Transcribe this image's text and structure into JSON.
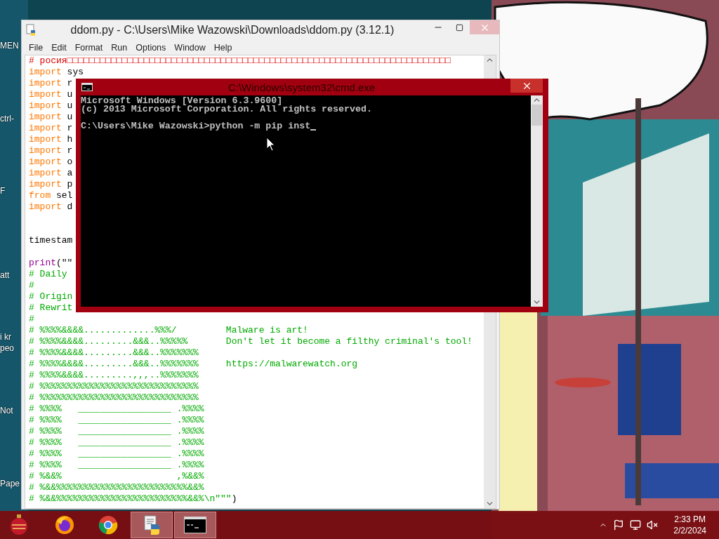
{
  "desktop_icons": [
    {
      "label": "MEN"
    },
    {
      "label": "ctrl-"
    },
    {
      "label": "F"
    },
    {
      "label": "att"
    },
    {
      "label": "i kr"
    },
    {
      "label": "peo"
    },
    {
      "label": "Not"
    },
    {
      "label": "Pape"
    }
  ],
  "editor": {
    "title": "ddom.py - C:\\Users\\Mike Wazowski\\Downloads\\ddom.py (3.12.1)",
    "menu": [
      "File",
      "Edit",
      "Format",
      "Run",
      "Options",
      "Window",
      "Help"
    ],
    "lines": [
      {
        "kind": "code",
        "segments": [
          {
            "text": "# росия□□□□□□□□□□□□□□□□□□□□□□□□□□□□□□□□□□□□□□□□□□□□□□□□□□□□□□□□□□□□□□□□□□□□□□",
            "kind": "comment"
          }
        ]
      },
      {
        "kind": "code",
        "segments": [
          {
            "text": "import",
            "kind": "keyword"
          },
          {
            "text": " sys",
            "kind": "plain"
          }
        ]
      },
      {
        "kind": "code",
        "segments": [
          {
            "text": "import",
            "kind": "keyword"
          },
          {
            "text": " r",
            "kind": "plain"
          }
        ]
      },
      {
        "kind": "code",
        "segments": [
          {
            "text": "import",
            "kind": "keyword"
          },
          {
            "text": " u",
            "kind": "plain"
          }
        ]
      },
      {
        "kind": "code",
        "segments": [
          {
            "text": "import",
            "kind": "keyword"
          },
          {
            "text": " u",
            "kind": "plain"
          }
        ]
      },
      {
        "kind": "code",
        "segments": [
          {
            "text": "import",
            "kind": "keyword"
          },
          {
            "text": " u",
            "kind": "plain"
          }
        ]
      },
      {
        "kind": "code",
        "segments": [
          {
            "text": "import",
            "kind": "keyword"
          },
          {
            "text": " r",
            "kind": "plain"
          }
        ]
      },
      {
        "kind": "code",
        "segments": [
          {
            "text": "import",
            "kind": "keyword"
          },
          {
            "text": " h",
            "kind": "plain"
          }
        ]
      },
      {
        "kind": "code",
        "segments": [
          {
            "text": "import",
            "kind": "keyword"
          },
          {
            "text": " r",
            "kind": "plain"
          }
        ]
      },
      {
        "kind": "code",
        "segments": [
          {
            "text": "import",
            "kind": "keyword"
          },
          {
            "text": " o",
            "kind": "plain"
          }
        ]
      },
      {
        "kind": "code",
        "segments": [
          {
            "text": "import",
            "kind": "keyword"
          },
          {
            "text": " a",
            "kind": "plain"
          }
        ]
      },
      {
        "kind": "code",
        "segments": [
          {
            "text": "import",
            "kind": "keyword"
          },
          {
            "text": " p",
            "kind": "plain"
          }
        ]
      },
      {
        "kind": "code",
        "segments": [
          {
            "text": "from",
            "kind": "keyword"
          },
          {
            "text": " sel",
            "kind": "plain"
          }
        ]
      },
      {
        "kind": "code",
        "segments": [
          {
            "text": "import",
            "kind": "keyword"
          },
          {
            "text": " d",
            "kind": "plain"
          }
        ]
      },
      {
        "kind": "blank"
      },
      {
        "kind": "blank"
      },
      {
        "kind": "code",
        "segments": [
          {
            "text": "timestam",
            "kind": "plain"
          }
        ]
      },
      {
        "kind": "blank"
      },
      {
        "kind": "code",
        "segments": [
          {
            "text": "print",
            "kind": "builtin"
          },
          {
            "text": "(\"\"",
            "kind": "plain"
          }
        ]
      },
      {
        "kind": "code",
        "segments": [
          {
            "text": "# Daily",
            "kind": "string"
          }
        ]
      },
      {
        "kind": "code",
        "segments": [
          {
            "text": "#",
            "kind": "string"
          }
        ]
      },
      {
        "kind": "code",
        "segments": [
          {
            "text": "# Origin",
            "kind": "string"
          }
        ]
      },
      {
        "kind": "code",
        "segments": [
          {
            "text": "# Rewrit",
            "kind": "string"
          }
        ]
      },
      {
        "kind": "code",
        "segments": [
          {
            "text": "#",
            "kind": "string"
          }
        ]
      },
      {
        "kind": "code",
        "segments": [
          {
            "text": "# %%%%&&&&.............%%%/         Malware is art!",
            "kind": "string"
          }
        ]
      },
      {
        "kind": "code",
        "segments": [
          {
            "text": "# %%%%&&&&.........&&&..%%%%%       Don't let it become a filthy criminal's tool!",
            "kind": "string"
          }
        ]
      },
      {
        "kind": "code",
        "segments": [
          {
            "text": "# %%%%&&&&.........&&&..%%%%%%%",
            "kind": "string"
          }
        ]
      },
      {
        "kind": "code",
        "segments": [
          {
            "text": "# %%%%&&&&.........&&&..%%%%%%%     https://malwarewatch.org",
            "kind": "string"
          }
        ]
      },
      {
        "kind": "code",
        "segments": [
          {
            "text": "# %%%%&&&&.........,,,..%%%%%%%",
            "kind": "string"
          }
        ]
      },
      {
        "kind": "code",
        "segments": [
          {
            "text": "# %%%%%%%%%%%%%%%%%%%%%%%%%%%%%",
            "kind": "string"
          }
        ]
      },
      {
        "kind": "code",
        "segments": [
          {
            "text": "# %%%%%%%%%%%%%%%%%%%%%%%%%%%%%",
            "kind": "string"
          }
        ]
      },
      {
        "kind": "code",
        "segments": [
          {
            "text": "# %%%%   _________________ .%%%%",
            "kind": "string"
          }
        ]
      },
      {
        "kind": "code",
        "segments": [
          {
            "text": "# %%%%   _________________ .%%%%",
            "kind": "string"
          }
        ]
      },
      {
        "kind": "code",
        "segments": [
          {
            "text": "# %%%%   _________________ .%%%%",
            "kind": "string"
          }
        ]
      },
      {
        "kind": "code",
        "segments": [
          {
            "text": "# %%%%   _________________ .%%%%",
            "kind": "string"
          }
        ]
      },
      {
        "kind": "code",
        "segments": [
          {
            "text": "# %%%%   _________________ .%%%%",
            "kind": "string"
          }
        ]
      },
      {
        "kind": "code",
        "segments": [
          {
            "text": "# %%%%   _________________ .%%%%",
            "kind": "string"
          }
        ]
      },
      {
        "kind": "code",
        "segments": [
          {
            "text": "# %&&%                     ,%&&%",
            "kind": "string"
          }
        ]
      },
      {
        "kind": "code",
        "segments": [
          {
            "text": "# %&&%%%%%%%%%%%%%%%%%%%%%%%%&&%",
            "kind": "string"
          }
        ]
      },
      {
        "kind": "code",
        "segments": [
          {
            "text": "# %&&%%%%%%%%%%%%%%%%%%%%%%%%&&%\\n\"\"\"",
            "kind": "string"
          },
          {
            "text": ")",
            "kind": "plain"
          }
        ]
      }
    ]
  },
  "console": {
    "title": "C:\\Windows\\system32\\cmd.exe",
    "lines": [
      {
        "kind": "output",
        "text": "Microsoft Windows [Version 6.3.9600]"
      },
      {
        "kind": "output",
        "text": "(c) 2013 Microsoft Corporation. All rights reserved."
      },
      {
        "kind": "blank"
      },
      {
        "kind": "prompt",
        "text": "C:\\Users\\Mike Wazowski>python -m pip inst"
      }
    ]
  },
  "taskbar": {
    "apps": [
      {
        "kind": "firefox",
        "selected": false
      },
      {
        "kind": "chrome",
        "selected": false
      },
      {
        "kind": "idle",
        "selected": true
      },
      {
        "kind": "terminal",
        "selected": true
      }
    ],
    "clock": {
      "time": "2:33 PM",
      "date": "2/2/2024"
    }
  }
}
